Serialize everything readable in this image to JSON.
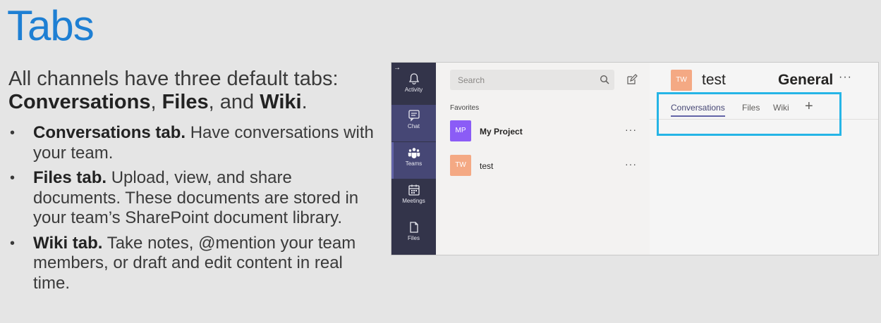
{
  "slide": {
    "title": "Tabs",
    "intro_text": "All channels have three default tabs:",
    "intro_conversations": "Conversations",
    "intro_comma": ", ",
    "intro_files": "Files",
    "intro_and": ", and ",
    "intro_wiki": "Wiki",
    "intro_period": ".",
    "bullets": [
      {
        "title": "Conversations tab.",
        "text": " Have conversations with your team."
      },
      {
        "title": "Files tab.",
        "text": " Upload, view, and share documents. These documents are stored in your team’s SharePoint document library."
      },
      {
        "title": "Wiki tab.",
        "text": " Take notes, @mention your team members, or draft and edit content in real time."
      }
    ],
    "bullet_glyph": "•"
  },
  "teams_app": {
    "rail": [
      {
        "label": "Activity",
        "icon": "bell-icon"
      },
      {
        "label": "Chat",
        "icon": "chat-icon"
      },
      {
        "label": "Teams",
        "icon": "teams-icon"
      },
      {
        "label": "Meetings",
        "icon": "calendar-icon"
      },
      {
        "label": "Files",
        "icon": "file-icon"
      }
    ],
    "rail_arrow": "→",
    "search_placeholder": "Search",
    "favorites_label": "Favorites",
    "teams": [
      {
        "initials": "MP",
        "name": "My Project",
        "color": "#8b5cf6",
        "more": "···"
      },
      {
        "initials": "TW",
        "name": "test",
        "color": "#f4a984",
        "more": "···"
      }
    ],
    "header": {
      "initials": "TW",
      "team": "test",
      "channel": "General",
      "more": "···"
    },
    "tabs": [
      "Conversations",
      "Files",
      "Wiki"
    ],
    "add_tab": "+",
    "colors": {
      "rail_bg": "#33344a",
      "accent": "#6264a7",
      "highlight_box": "#26b5e6"
    }
  }
}
